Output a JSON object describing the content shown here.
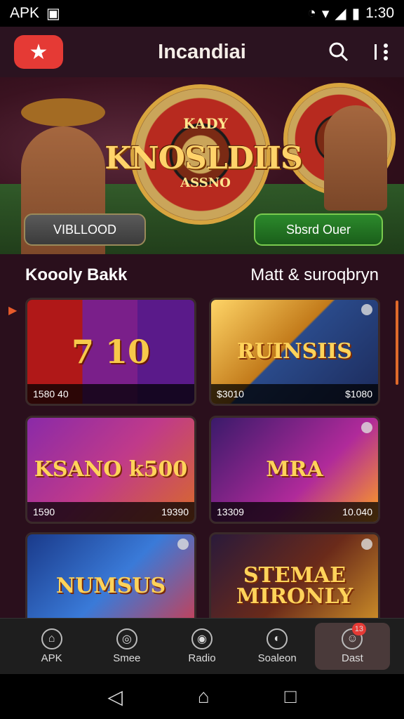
{
  "status_bar": {
    "left_label": "APK",
    "time": "1:30",
    "icons": [
      "alarm-icon",
      "wifi-icon",
      "signal-icon",
      "battery-icon"
    ]
  },
  "header": {
    "logo_icon": "star-logo-icon",
    "title": "Incandiai",
    "actions": [
      "search-icon",
      "more-vert-icon"
    ]
  },
  "hero": {
    "badge": "KADY",
    "title": "KNOSLDIIS",
    "subtitle": "ASSNO",
    "left_button": "VIBLLOOD",
    "right_button": "Sbsrd Ouer"
  },
  "section": {
    "title": "Koooly Bakk",
    "link": "Matt & suroqbryn"
  },
  "cards": [
    {
      "name": "7  10",
      "left": "1580 40",
      "right": ""
    },
    {
      "name": "RUINSIIS",
      "left": "$3010",
      "right": "$1080"
    },
    {
      "name": "KSANO  k500",
      "left": "1590",
      "right": "19390"
    },
    {
      "name": "MRA",
      "left": "13309",
      "right": "10.040"
    },
    {
      "name": "NUMSUS",
      "left": "",
      "right": ""
    },
    {
      "name": "STEMAE MIRONLY",
      "left": "",
      "right": ""
    }
  ],
  "bottom_nav": [
    {
      "label": "APK",
      "icon": "home-icon"
    },
    {
      "label": "Smee",
      "icon": "sports-icon"
    },
    {
      "label": "Radio",
      "icon": "radio-icon"
    },
    {
      "label": "Soaleon",
      "icon": "eye-icon"
    },
    {
      "label": "Dast",
      "icon": "profile-icon",
      "badge": "13"
    }
  ],
  "colors": {
    "accent": "#e53a35",
    "background": "#2a0f1c",
    "primary_button": "#2c8a2c"
  }
}
